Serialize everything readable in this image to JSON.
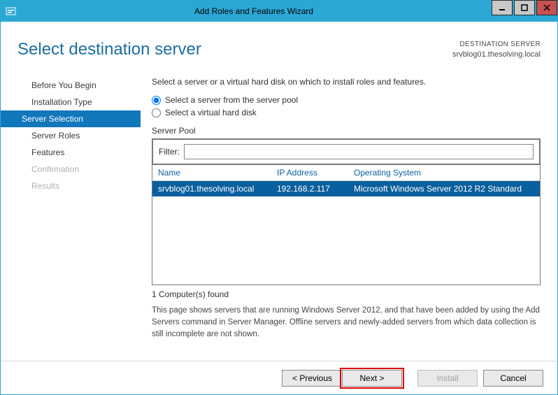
{
  "titlebar": {
    "title": "Add Roles and Features Wizard"
  },
  "header": {
    "pageTitle": "Select destination server",
    "destLabel": "DESTINATION SERVER",
    "destServer": "srvblog01.thesolving.local"
  },
  "sidebar": {
    "items": [
      {
        "label": "Before You Begin",
        "state": "normal"
      },
      {
        "label": "Installation Type",
        "state": "normal"
      },
      {
        "label": "Server Selection",
        "state": "active"
      },
      {
        "label": "Server Roles",
        "state": "normal"
      },
      {
        "label": "Features",
        "state": "normal"
      },
      {
        "label": "Confirmation",
        "state": "disabled"
      },
      {
        "label": "Results",
        "state": "disabled"
      }
    ]
  },
  "main": {
    "intro": "Select a server or a virtual hard disk on which to install roles and features.",
    "radio1": "Select a server from the server pool",
    "radio2": "Select a virtual hard disk",
    "poolLabel": "Server Pool",
    "filterLabel": "Filter:",
    "filterValue": "",
    "columns": {
      "name": "Name",
      "ip": "IP Address",
      "os": "Operating System"
    },
    "rows": [
      {
        "name": "srvblog01.thesolving.local",
        "ip": "192.168.2.117",
        "os": "Microsoft Windows Server 2012 R2 Standard"
      }
    ],
    "found": "1 Computer(s) found",
    "desc": "This page shows servers that are running Windows Server 2012, and that have been added by using the Add Servers command in Server Manager. Offline servers and newly-added servers from which data collection is still incomplete are not shown."
  },
  "footer": {
    "prev": "< Previous",
    "next": "Next >",
    "install": "Install",
    "cancel": "Cancel"
  }
}
